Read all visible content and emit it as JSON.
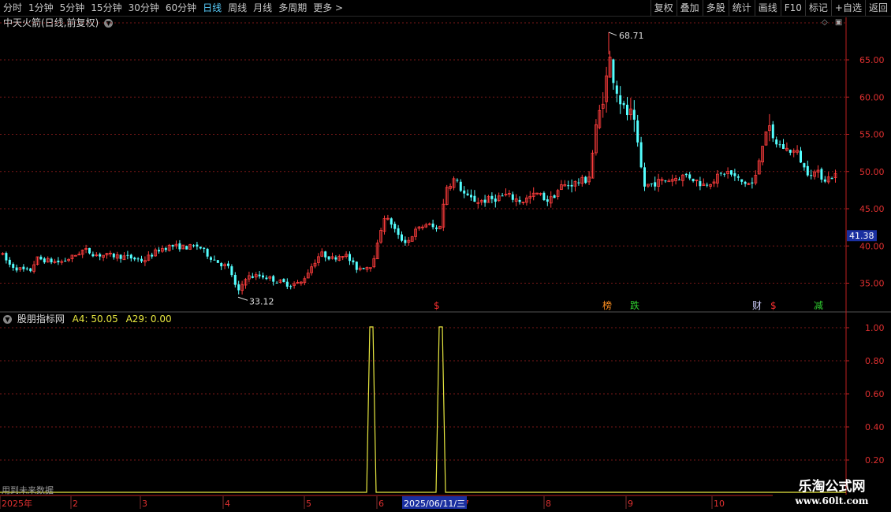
{
  "toolbar": {
    "periods": [
      "分时",
      "1分钟",
      "5分钟",
      "15分钟",
      "30分钟",
      "60分钟",
      "日线",
      "周线",
      "月线",
      "多周期",
      "更多 >"
    ],
    "active_period": "日线",
    "actions": [
      "复权",
      "叠加",
      "多股",
      "统计",
      "画线",
      "F10",
      "标记",
      "+自选",
      "返回"
    ]
  },
  "main_chart": {
    "title": "中天火箭(日线,前复权)",
    "y_ticks": [
      "65.00",
      "60.00",
      "55.00",
      "50.00",
      "45.00",
      "40.00",
      "35.00"
    ],
    "current_price": "41.38",
    "high_label": "68.71",
    "low_label": "33.12",
    "markers": [
      {
        "text": "$",
        "color": "#ff3030"
      },
      {
        "text": "榜",
        "color": "#ff9020"
      },
      {
        "text": "跌",
        "color": "#30d030"
      },
      {
        "text": "财",
        "color": "#d0d0ff"
      },
      {
        "text": "$",
        "color": "#ff3030"
      },
      {
        "text": "减",
        "color": "#30d030"
      }
    ]
  },
  "indicator": {
    "name": "股朋指标网",
    "a4": "A4: 50.05",
    "a29": "A29: 0.00",
    "y_ticks": [
      "1.00",
      "0.80",
      "0.60",
      "0.40",
      "0.20"
    ],
    "note": "用到未来数据"
  },
  "date_axis": {
    "labels": [
      "2025年",
      "2",
      "3",
      "4",
      "5",
      "6",
      "7",
      "8",
      "9",
      "10"
    ],
    "cursor_date": "2025/06/11/三"
  },
  "watermark": {
    "line1": "乐淘公式网",
    "line2": "www.60lt.com"
  },
  "colors": {
    "up": "#ff3d3d",
    "down": "#54ffff",
    "grid": "#7a1818",
    "axis": "#c02020",
    "indicator_line": "#e8e840"
  },
  "chart_data": {
    "type": "candlestick",
    "x_range": [
      "2025-01",
      "2025-10"
    ],
    "ylim": [
      31.5,
      69
    ],
    "high": 68.71,
    "low": 33.12,
    "last": 41.38,
    "indicator_series": {
      "name": "股朋指标网",
      "values_description": "0 except two spikes to 1.00 in June 2025",
      "spikes": [
        1.0,
        1.0
      ],
      "ylim": [
        0,
        1.05
      ]
    }
  }
}
